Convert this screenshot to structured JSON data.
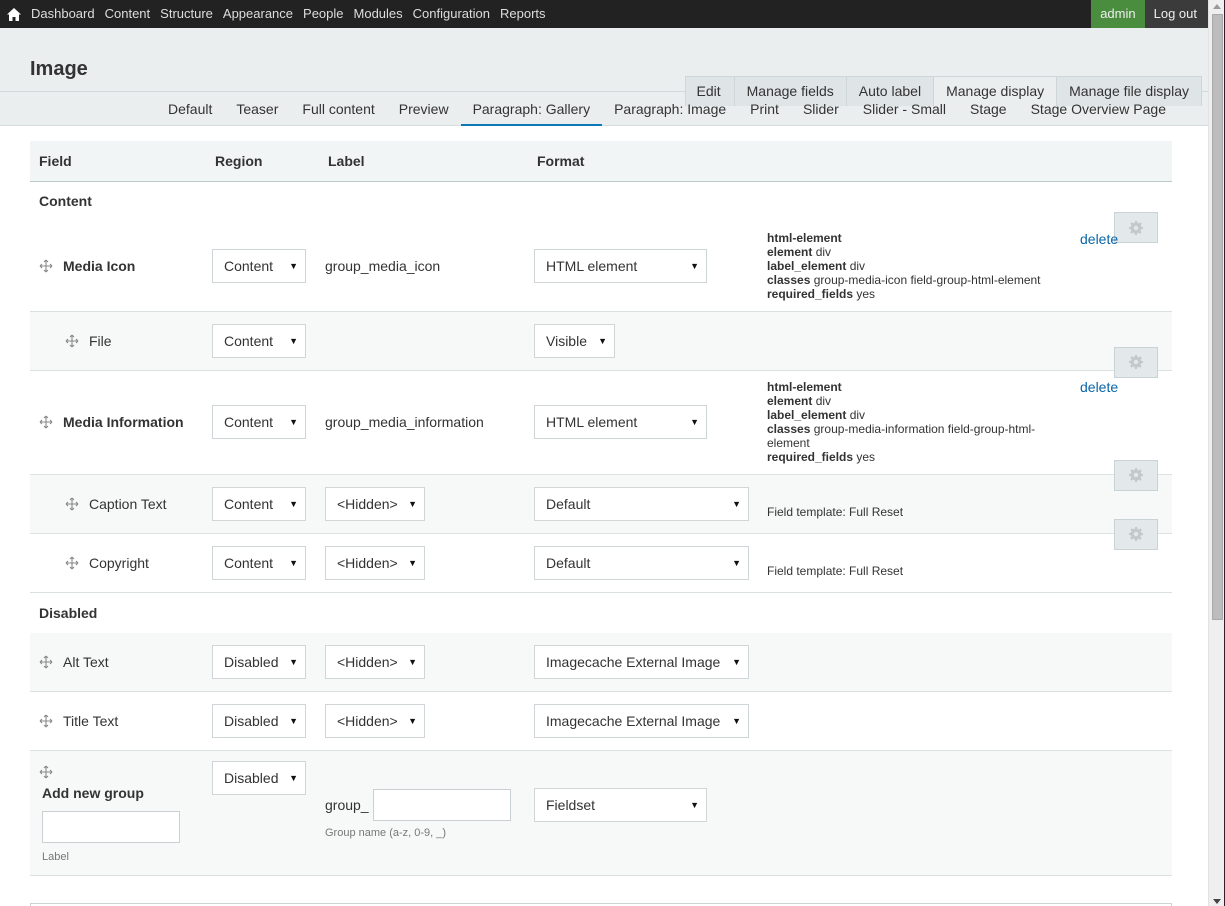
{
  "toolbar": {
    "home_icon": "home-icon",
    "menu": [
      "Dashboard",
      "Content",
      "Structure",
      "Appearance",
      "People",
      "Modules",
      "Configuration",
      "Reports"
    ],
    "user": "admin",
    "logout": "Log out",
    "user_color": "#4a8d3f"
  },
  "header": {
    "title": "Image",
    "primary_tabs": [
      "Edit",
      "Manage fields",
      "Auto label",
      "Manage display",
      "Manage file display"
    ],
    "primary_active": "Manage display",
    "secondary_tabs": [
      "Default",
      "Teaser",
      "Full content",
      "Preview",
      "Paragraph: Gallery",
      "Paragraph: Image",
      "Print",
      "Slider",
      "Slider - Small",
      "Stage",
      "Stage Overview Page"
    ],
    "secondary_active": "Paragraph: Gallery",
    "accent_color": "#0a77b7"
  },
  "table": {
    "columns": [
      "Field",
      "Region",
      "Label",
      "Format"
    ],
    "regions": {
      "content": "Content",
      "disabled": "Disabled"
    },
    "rows": {
      "media_icon": {
        "field": "Media Icon",
        "region": "Content",
        "label": "group_media_icon",
        "format": "HTML element",
        "summary": {
          "type": "html-element",
          "element_key": "element",
          "element_val": "div",
          "label_element_key": "label_element",
          "label_element_val": "div",
          "classes_key": "classes",
          "classes_val": "group-media-icon field-group-html-element",
          "required_key": "required_fields",
          "required_val": "yes"
        },
        "delete": "delete"
      },
      "file": {
        "field": "File",
        "region": "Content",
        "format": "Visible"
      },
      "media_information": {
        "field": "Media Information",
        "region": "Content",
        "label": "group_media_information",
        "format": "HTML element",
        "summary": {
          "type": "html-element",
          "element_key": "element",
          "element_val": "div",
          "label_element_key": "label_element",
          "label_element_val": "div",
          "classes_key": "classes",
          "classes_val": "group-media-information field-group-html-element",
          "required_key": "required_fields",
          "required_val": "yes"
        },
        "delete": "delete"
      },
      "caption_text": {
        "field": "Caption Text",
        "region": "Content",
        "label": "<Hidden>",
        "format": "Default",
        "summary": "Field template: Full Reset"
      },
      "copyright": {
        "field": "Copyright",
        "region": "Content",
        "label": "<Hidden>",
        "format": "Default",
        "summary": "Field template: Full Reset"
      },
      "alt_text": {
        "field": "Alt Text",
        "region": "Disabled",
        "label": "<Hidden>",
        "format": "Imagecache External Image"
      },
      "title_text": {
        "field": "Title Text",
        "region": "Disabled",
        "label": "<Hidden>",
        "format": "Imagecache External Image"
      },
      "add_group": {
        "title": "Add new group",
        "region": "Disabled",
        "label_value": "",
        "label_hint": "Label",
        "prefix": "group_",
        "name_value": "",
        "name_hint": "Group name (a-z, 0-9, _)",
        "format": "Fieldset"
      }
    }
  }
}
